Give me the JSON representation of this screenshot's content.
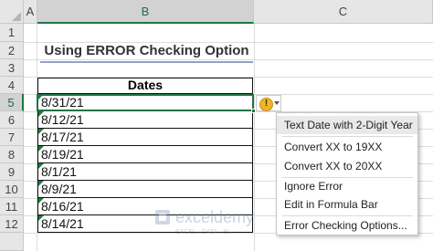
{
  "columns": [
    "A",
    "B",
    "C"
  ],
  "rows": [
    "1",
    "2",
    "3",
    "4",
    "5",
    "6",
    "7",
    "8",
    "9",
    "10",
    "11",
    "12"
  ],
  "title": "Using ERROR Checking Option",
  "table": {
    "header": "Dates",
    "values": [
      "8/31/21",
      "8/12/21",
      "8/17/21",
      "8/19/21",
      "8/1/21",
      "8/9/21",
      "8/16/21",
      "8/14/21"
    ]
  },
  "smart_tag": {
    "icon": "warning-icon"
  },
  "menu": {
    "items": [
      "Text Date with 2-Digit Year",
      "Convert XX to 19XX",
      "Convert XX to 20XX",
      "Ignore Error",
      "Edit in Formula Bar",
      "Error Checking Options..."
    ]
  },
  "watermark": {
    "name": "exceldemy",
    "tagline": "EXCEL · DATA · BI"
  },
  "colors": {
    "accent": "#217346",
    "error_marker": "#1d7a3e",
    "warning": "#f2b32c"
  }
}
